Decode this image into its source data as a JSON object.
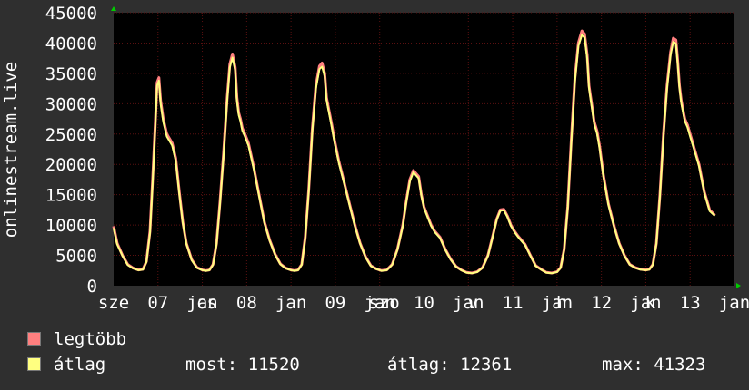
{
  "chart_data": {
    "type": "area",
    "ylabel": "onlinestream.live",
    "ylim": [
      0,
      45000
    ],
    "yticks": [
      0,
      5000,
      10000,
      15000,
      20000,
      25000,
      30000,
      35000,
      40000,
      45000
    ],
    "xlim": [
      0,
      7
    ],
    "grid": true,
    "x_tick_labels": [
      {
        "x": 0.0,
        "label": "sze"
      },
      {
        "x": 0.5,
        "label": "07"
      },
      {
        "x": 1.0,
        "label": "jan"
      },
      {
        "x": 1.05,
        "label": "cs"
      },
      {
        "x": 1.5,
        "label": "08"
      },
      {
        "x": 2.0,
        "label": "jan"
      },
      {
        "x": 2.5,
        "label": "09"
      },
      {
        "x": 3.0,
        "label": "jan"
      },
      {
        "x": 3.05,
        "label": "szo"
      },
      {
        "x": 3.5,
        "label": "10"
      },
      {
        "x": 4.0,
        "label": "jan"
      },
      {
        "x": 4.05,
        "label": "v"
      },
      {
        "x": 4.5,
        "label": "11"
      },
      {
        "x": 5.0,
        "label": "jan"
      },
      {
        "x": 5.05,
        "label": "h"
      },
      {
        "x": 5.5,
        "label": "12"
      },
      {
        "x": 6.0,
        "label": "jan"
      },
      {
        "x": 6.05,
        "label": "k"
      },
      {
        "x": 6.5,
        "label": "13"
      },
      {
        "x": 7.0,
        "label": "jan"
      }
    ],
    "x": [
      0.0,
      0.04,
      0.1,
      0.16,
      0.22,
      0.28,
      0.33,
      0.37,
      0.41,
      0.44,
      0.47,
      0.49,
      0.51,
      0.53,
      0.56,
      0.6,
      0.66,
      0.7,
      0.74,
      0.78,
      0.82,
      0.88,
      0.94,
      1.0,
      1.04,
      1.08,
      1.12,
      1.16,
      1.2,
      1.24,
      1.28,
      1.31,
      1.34,
      1.37,
      1.39,
      1.41,
      1.43,
      1.45,
      1.48,
      1.52,
      1.58,
      1.64,
      1.7,
      1.76,
      1.82,
      1.88,
      1.94,
      2.0,
      2.04,
      2.08,
      2.12,
      2.16,
      2.2,
      2.24,
      2.28,
      2.32,
      2.35,
      2.38,
      2.4,
      2.42,
      2.44,
      2.46,
      2.49,
      2.54,
      2.6,
      2.66,
      2.72,
      2.78,
      2.84,
      2.9,
      2.96,
      3.02,
      3.08,
      3.14,
      3.2,
      3.26,
      3.3,
      3.34,
      3.38,
      3.41,
      3.44,
      3.47,
      3.5,
      3.54,
      3.58,
      3.62,
      3.68,
      3.74,
      3.8,
      3.86,
      3.92,
      3.98,
      4.04,
      4.1,
      4.16,
      4.22,
      4.28,
      4.32,
      4.36,
      4.4,
      4.44,
      4.48,
      4.52,
      4.56,
      4.6,
      4.64,
      4.7,
      4.76,
      4.82,
      4.88,
      4.94,
      5.0,
      5.04,
      5.08,
      5.12,
      5.16,
      5.2,
      5.24,
      5.28,
      5.31,
      5.34,
      5.36,
      5.38,
      5.4,
      5.42,
      5.45,
      5.48,
      5.52,
      5.58,
      5.64,
      5.7,
      5.76,
      5.82,
      5.88,
      5.94,
      6.0,
      6.04,
      6.08,
      6.12,
      6.16,
      6.2,
      6.24,
      6.28,
      6.31,
      6.34,
      6.36,
      6.38,
      6.4,
      6.42,
      6.44,
      6.47,
      6.5,
      6.55,
      6.6,
      6.66,
      6.72,
      6.78,
      6.84,
      6.88,
      6.92,
      6.96
    ],
    "series": [
      {
        "name": "legtöbb",
        "color": "#ff7f7f",
        "values": [
          9800,
          7000,
          5000,
          3500,
          2900,
          2600,
          2700,
          4000,
          9000,
          17500,
          27000,
          33500,
          34300,
          30500,
          27500,
          25000,
          23500,
          21000,
          15500,
          10500,
          7000,
          4300,
          3000,
          2600,
          2500,
          2600,
          3500,
          7000,
          14000,
          22000,
          31000,
          36500,
          38200,
          36000,
          31000,
          28500,
          27500,
          26000,
          25000,
          23500,
          19500,
          15000,
          10500,
          7500,
          5200,
          3600,
          2900,
          2600,
          2500,
          2600,
          3500,
          8000,
          16000,
          26000,
          33000,
          36200,
          36700,
          35000,
          31000,
          29500,
          28000,
          26500,
          24000,
          20500,
          17000,
          13500,
          10000,
          7000,
          4800,
          3300,
          2800,
          2500,
          2600,
          3500,
          6000,
          10000,
          14000,
          17500,
          19000,
          18500,
          18000,
          15000,
          13000,
          11500,
          10000,
          9000,
          8000,
          6000,
          4400,
          3200,
          2600,
          2200,
          2100,
          2300,
          3000,
          5000,
          8500,
          11000,
          12500,
          12600,
          11500,
          10000,
          9000,
          8200,
          7500,
          6800,
          5000,
          3300,
          2700,
          2200,
          2100,
          2300,
          3000,
          6000,
          13000,
          24000,
          34000,
          40000,
          42000,
          41500,
          38000,
          33000,
          31000,
          29000,
          27000,
          25500,
          23000,
          18500,
          13500,
          10000,
          7000,
          5000,
          3500,
          3000,
          2700,
          2600,
          2700,
          3500,
          7000,
          15000,
          25000,
          33000,
          38500,
          40800,
          40500,
          37000,
          33000,
          30500,
          29000,
          27500,
          26500,
          25000,
          22500,
          20000,
          15500,
          12500,
          11600
        ]
      },
      {
        "name": "átlag",
        "color": "#ffff80",
        "values": [
          9500,
          6800,
          4900,
          3400,
          2850,
          2550,
          2650,
          3900,
          8700,
          17000,
          26500,
          33000,
          33800,
          30000,
          27000,
          24600,
          23100,
          20600,
          15200,
          10300,
          6900,
          4200,
          2950,
          2550,
          2450,
          2550,
          3450,
          6800,
          13700,
          21600,
          30500,
          36000,
          37600,
          35500,
          30500,
          28100,
          27100,
          25600,
          24600,
          23100,
          19200,
          14800,
          10300,
          7400,
          5100,
          3550,
          2850,
          2550,
          2450,
          2550,
          3450,
          7800,
          15700,
          25600,
          32500,
          35700,
          36100,
          34500,
          30600,
          29100,
          27600,
          26100,
          23600,
          20200,
          16800,
          13300,
          9800,
          6900,
          4700,
          3250,
          2750,
          2450,
          2550,
          3450,
          5900,
          9800,
          13800,
          17200,
          18700,
          18200,
          17700,
          14800,
          12800,
          11300,
          9850,
          8850,
          7850,
          5900,
          4300,
          3150,
          2550,
          2150,
          2050,
          2250,
          2950,
          4900,
          8400,
          10900,
          12350,
          12450,
          11350,
          9850,
          8850,
          8050,
          7350,
          6700,
          4900,
          3250,
          2650,
          2150,
          2050,
          2250,
          2950,
          5900,
          12800,
          23600,
          33500,
          39500,
          41300,
          40900,
          37500,
          32600,
          30600,
          28600,
          26600,
          25100,
          22600,
          18200,
          13300,
          9850,
          6900,
          4900,
          3450,
          2950,
          2650,
          2550,
          2650,
          3450,
          6900,
          14800,
          24600,
          32500,
          38000,
          40200,
          39900,
          36500,
          32600,
          30100,
          28600,
          27100,
          26100,
          24600,
          22200,
          19700,
          15300,
          12300,
          11520
        ]
      }
    ]
  },
  "legend": {
    "items": [
      {
        "label": "legtöbb",
        "color": "#ff7f7f"
      },
      {
        "label": "átlag",
        "color": "#ffff80"
      }
    ],
    "stats": {
      "current": "most: 11520",
      "average": "átlag: 12361",
      "max": "max: 41323"
    }
  },
  "colors": {
    "background": "#2f2f2f",
    "plot_background": "#000000",
    "grid": "#5a1010",
    "text": "#ffffff",
    "axis_arrow": "#00cc00"
  }
}
